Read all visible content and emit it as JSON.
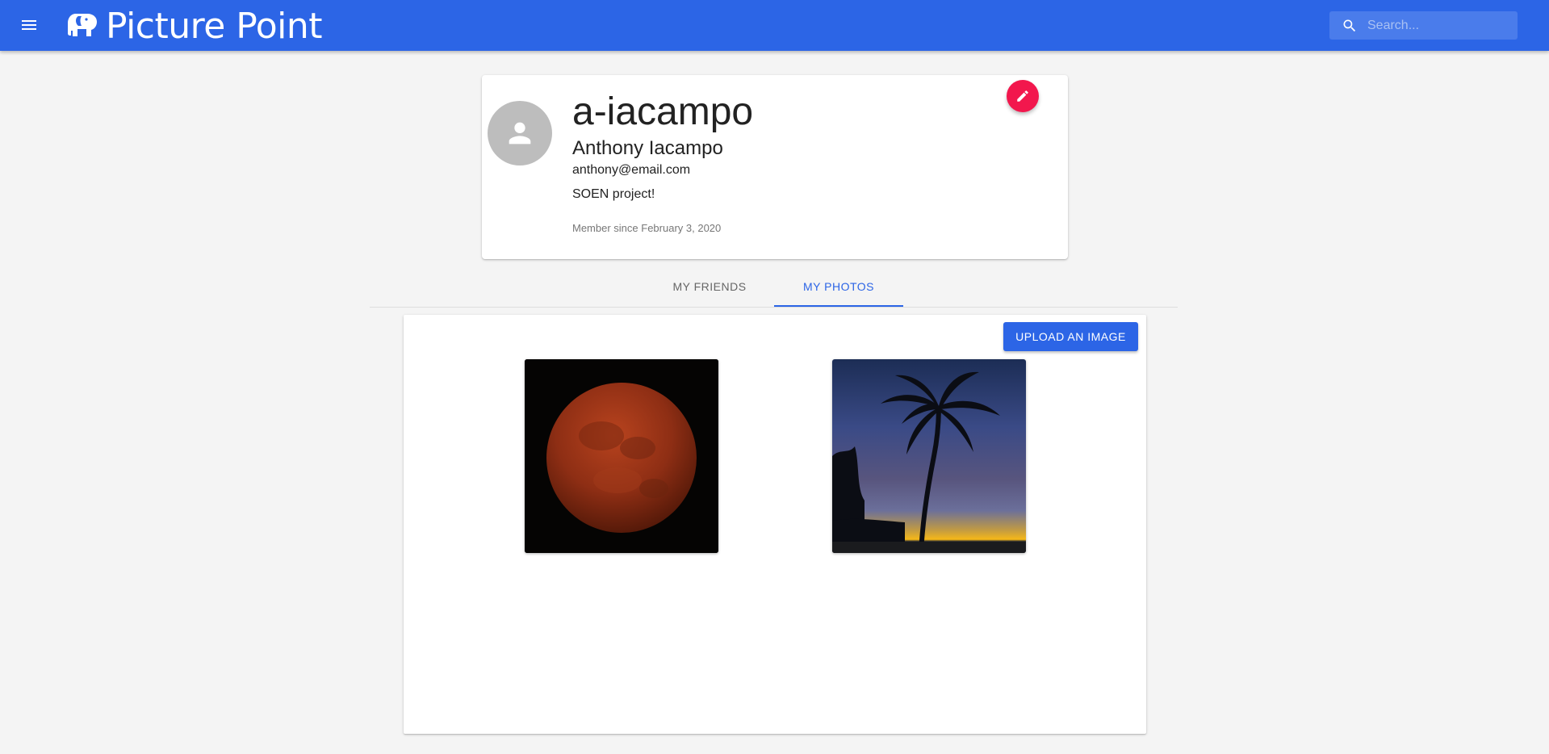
{
  "app": {
    "brand_name": "Picture Point",
    "brand_color": "#2c65e6"
  },
  "header": {
    "menu_icon": "hamburger-menu-icon",
    "logo_icon": "elephant-logo-icon",
    "search": {
      "icon": "search-icon",
      "placeholder": "Search...",
      "value": ""
    }
  },
  "profile": {
    "avatar_icon": "person-icon",
    "username": "a-iacampo",
    "full_name": "Anthony Iacampo",
    "email": "anthony@email.com",
    "bio": "SOEN project!",
    "member_since": "Member since February 3, 2020",
    "edit_icon": "pencil-icon",
    "edit_color": "#f2174d"
  },
  "tabs": [
    {
      "label": "MY FRIENDS",
      "active": false
    },
    {
      "label": "MY PHOTOS",
      "active": true
    }
  ],
  "photos_panel": {
    "upload_label": "UPLOAD AN IMAGE",
    "photos": [
      {
        "subject": "blood-moon"
      },
      {
        "subject": "palm-tree-sunset"
      }
    ]
  }
}
